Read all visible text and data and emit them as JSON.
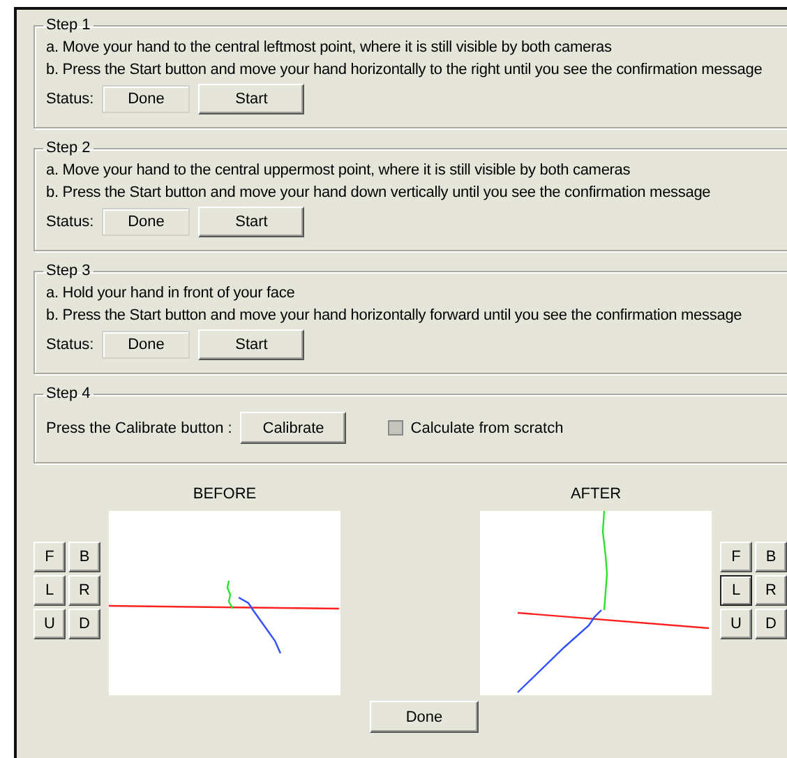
{
  "steps": [
    {
      "kind": "instructions",
      "title": "Step 1",
      "lines": [
        "a. Move your hand to the central leftmost point, where it is still visible by both cameras",
        "b. Press the Start button and move your hand horizontally to the right until you see the confirmation message"
      ],
      "status_label": "Status:",
      "status": "Done",
      "button": "Start"
    },
    {
      "kind": "instructions",
      "title": "Step 2",
      "lines": [
        "a. Move your hand to the central uppermost point, where it is still visible by both cameras",
        "b. Press the Start button and move your hand down vertically until you see the confirmation message"
      ],
      "status_label": "Status:",
      "status": "Done",
      "button": "Start"
    },
    {
      "kind": "instructions",
      "title": "Step 3",
      "lines": [
        "a. Hold your hand in front of your face",
        "b. Press the Start button and move your hand horizontally forward until you see the confirmation message"
      ],
      "status_label": "Status:",
      "status": "Done",
      "button": "Start"
    },
    {
      "kind": "calibrate",
      "title": "Step 4",
      "prompt": "Press the Calibrate button :",
      "button": "Calibrate",
      "checkbox": {
        "label": "Calculate from scratch",
        "checked": false,
        "disabled": true
      }
    }
  ],
  "views": [
    {
      "title": "BEFORE",
      "kind": "left",
      "buttons": [
        {
          "label": "F",
          "selected": false
        },
        {
          "label": "B",
          "selected": false
        },
        {
          "label": "L",
          "selected": false
        },
        {
          "label": "R",
          "selected": false
        },
        {
          "label": "U",
          "selected": false
        },
        {
          "label": "D",
          "selected": false
        }
      ]
    },
    {
      "title": "AFTER",
      "kind": "right",
      "buttons": [
        {
          "label": "F",
          "selected": false
        },
        {
          "label": "B",
          "selected": false
        },
        {
          "label": "L",
          "selected": true
        },
        {
          "label": "R",
          "selected": false
        },
        {
          "label": "U",
          "selected": false
        },
        {
          "label": "D",
          "selected": false
        }
      ]
    }
  ],
  "done_button": "Done"
}
